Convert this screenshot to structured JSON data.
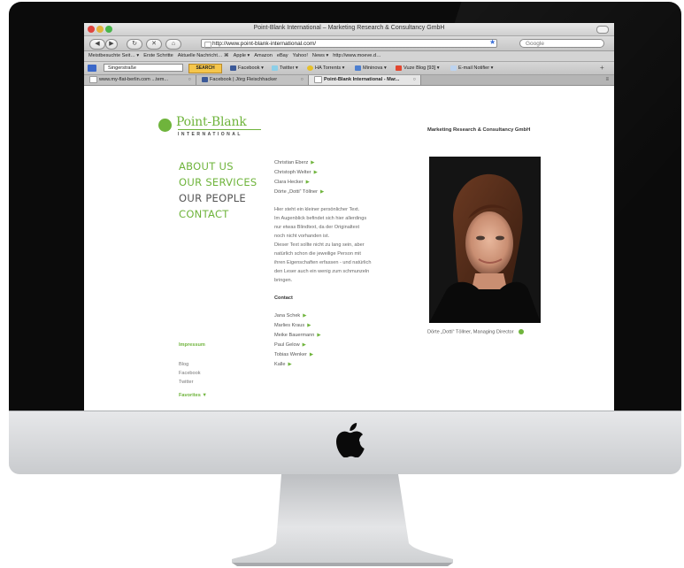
{
  "browser": {
    "window_title": "Point-Blank International – Marketing Research & Consultancy GmbH",
    "url": "http://www.point-blank-international.com/",
    "search_placeholder": "Google",
    "bookmarks": [
      "Meistbesuchte Seit… ▾",
      "Erste Schritte",
      "Aktuelle Nachricht… ⌘",
      "Apple ▾",
      "Amazon",
      "eBay",
      "Yahoo!",
      "News ▾",
      "http://www.moeve.d…"
    ],
    "toolbar2": {
      "address_input": "Singerstraße",
      "search_btn": "SEARCH",
      "items": [
        "Facebook ▾",
        "Twitter ▾",
        "HA Torrents ▾",
        "Mininova ▾",
        "Vuze Blog [93] ▾",
        "E-mail Notifier ▾"
      ]
    },
    "tabs": [
      {
        "label": "www.my-flat-berlin.com ...tem..."
      },
      {
        "label": "Facebook | Jörg Fleischhacker"
      },
      {
        "label": "Point-Blank International - Mar..."
      }
    ]
  },
  "site": {
    "logo_name": "Point-Blank",
    "logo_sub": "INTERNATIONAL",
    "tagline": "Marketing Research & Consultancy GmbH",
    "nav": {
      "about": "ABOUT US",
      "services": "OUR SERVICES",
      "people": "OUR PEOPLE",
      "contact": "CONTACT"
    },
    "people": [
      "Christian Eberz",
      "Christoph Welter",
      "Clara Hecker",
      "Dörte „Dotti“ Töllner"
    ],
    "bio_lines": [
      "Hier steht ein kleiner persönlicher Text.",
      "Im Augenblick befindet sich hier allerdings",
      "nur etwas Blindtext, da der Originaltext",
      "noch nicht vorhanden ist.",
      "Dieser Text sollte nicht zu lang sein, aber",
      "natürlich schon die jeweilige Person mit",
      "ihren Eigenschaften erfassen - und natürlich",
      "den Leser auch ein wenig zum schmunzeln",
      "bringen."
    ],
    "contact_heading": "Contact",
    "contacts": [
      "Jana Schek",
      "Marlies Kraus",
      "Meike Bauermann",
      "Paul Gelow",
      "Tobias Wenker",
      "Kalle"
    ],
    "imprint": "Impressum",
    "links": [
      "Blog",
      "Facebook",
      "Twitter"
    ],
    "favorites": "Favorites ▼",
    "caption": "Dörte „Dotti“ Töllner, Managing Director"
  },
  "colors": {
    "brand_green": "#6fb43c",
    "bezel": "#0b0b0b"
  }
}
